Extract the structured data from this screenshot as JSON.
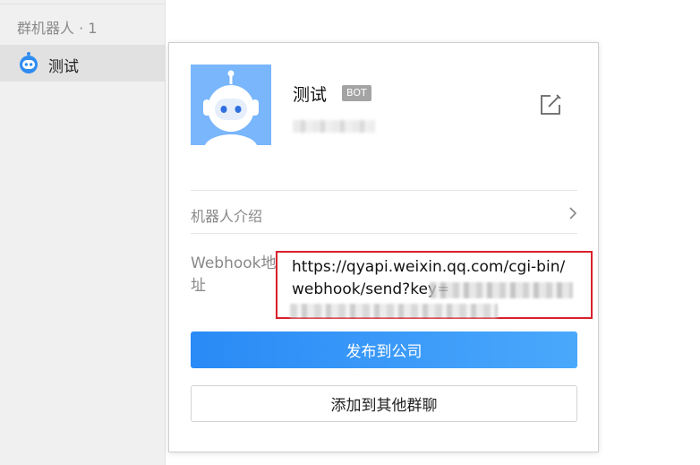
{
  "sidebar": {
    "group_header": "群机器人 · 1",
    "bot_item_label": "测试"
  },
  "card": {
    "bot_name": "测试",
    "badge": "BOT",
    "intro_label": "机器人介绍",
    "webhook_label": "Webhook地址",
    "webhook_url_line1": "https://qyapi.weixin.qq.com/cgi-bin/",
    "webhook_url_line2": "webhook/send?key=",
    "publish_button": "发布到公司",
    "add_group_button": "添加到其他群聊"
  },
  "colors": {
    "accent": "#2a8af6",
    "highlight_border": "#d8202b",
    "avatar_bg": "#79b6fb"
  },
  "icons": [
    "robot-icon",
    "robot-avatar-icon",
    "edit-icon",
    "chevron-right-icon"
  ]
}
